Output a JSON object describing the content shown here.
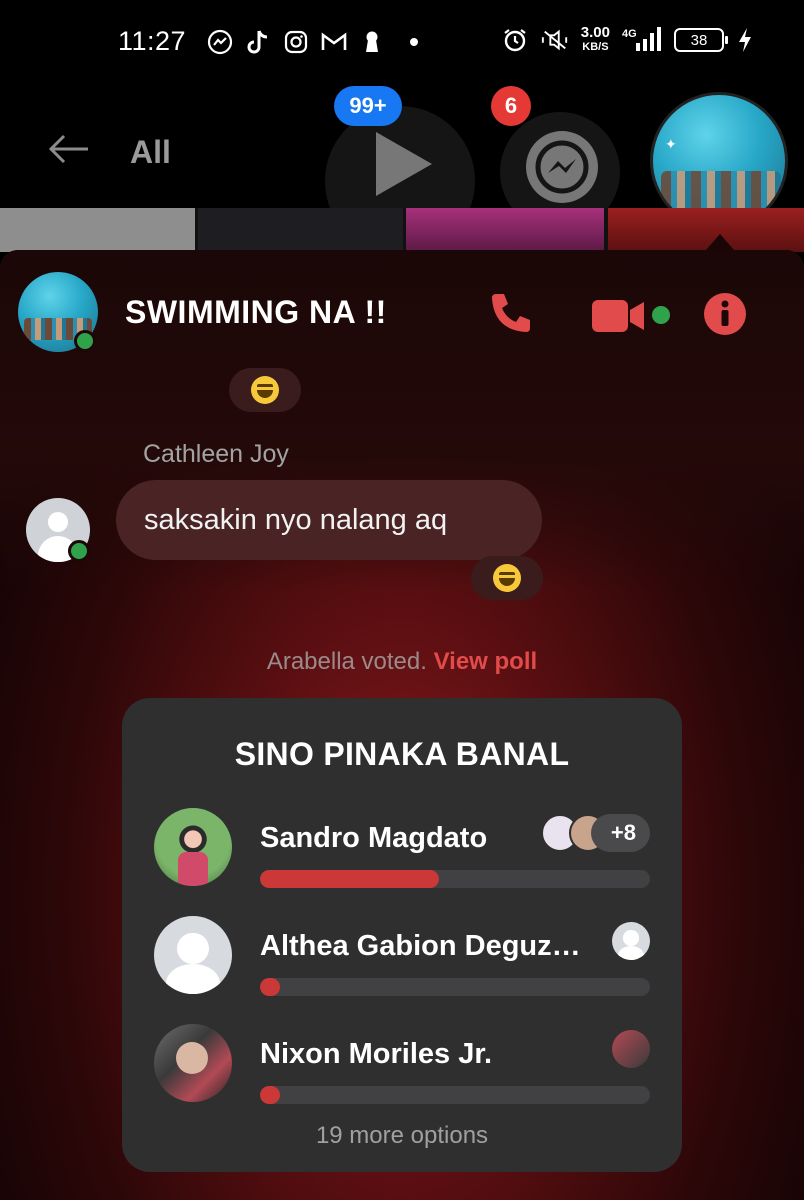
{
  "status_bar": {
    "time": "11:27",
    "speed_value": "3.00",
    "speed_unit": "KB/S",
    "network": "4G",
    "battery": "38",
    "left_icons": [
      "messenger-icon",
      "tiktok-icon",
      "instagram-icon",
      "gmail-icon",
      "keyhole-icon"
    ],
    "right_icons": [
      "alarm-icon",
      "mute-icon",
      "signal-icon",
      "battery-icon",
      "charging-icon"
    ]
  },
  "nav": {
    "filter_label": "All",
    "video_badge": "99+",
    "messenger_badge": "6"
  },
  "chat": {
    "title": "SWIMMING NA !!",
    "messages": [
      {
        "sender": "Cathleen Joy",
        "text": "saksakin nyo nalang aq"
      }
    ],
    "system_text": "Arabella voted.",
    "system_link": "View poll"
  },
  "poll": {
    "title": "SINO PINAKA BANAL",
    "options": [
      {
        "name": "Sandro Magdato",
        "fill": 0.46,
        "extra_voters": "+8"
      },
      {
        "name": "Althea Gabion Deguz…",
        "fill": 0.05
      },
      {
        "name": "Nixon Moriles Jr.",
        "fill": 0.05
      }
    ],
    "more_text": "19 more options"
  },
  "colors": {
    "accent": "#e14b4b",
    "online": "#31a24c",
    "badge_blue": "#1877f2",
    "badge_red": "#e53935",
    "poll_card": "#2f2f30",
    "poll_fill": "#cc3838"
  }
}
